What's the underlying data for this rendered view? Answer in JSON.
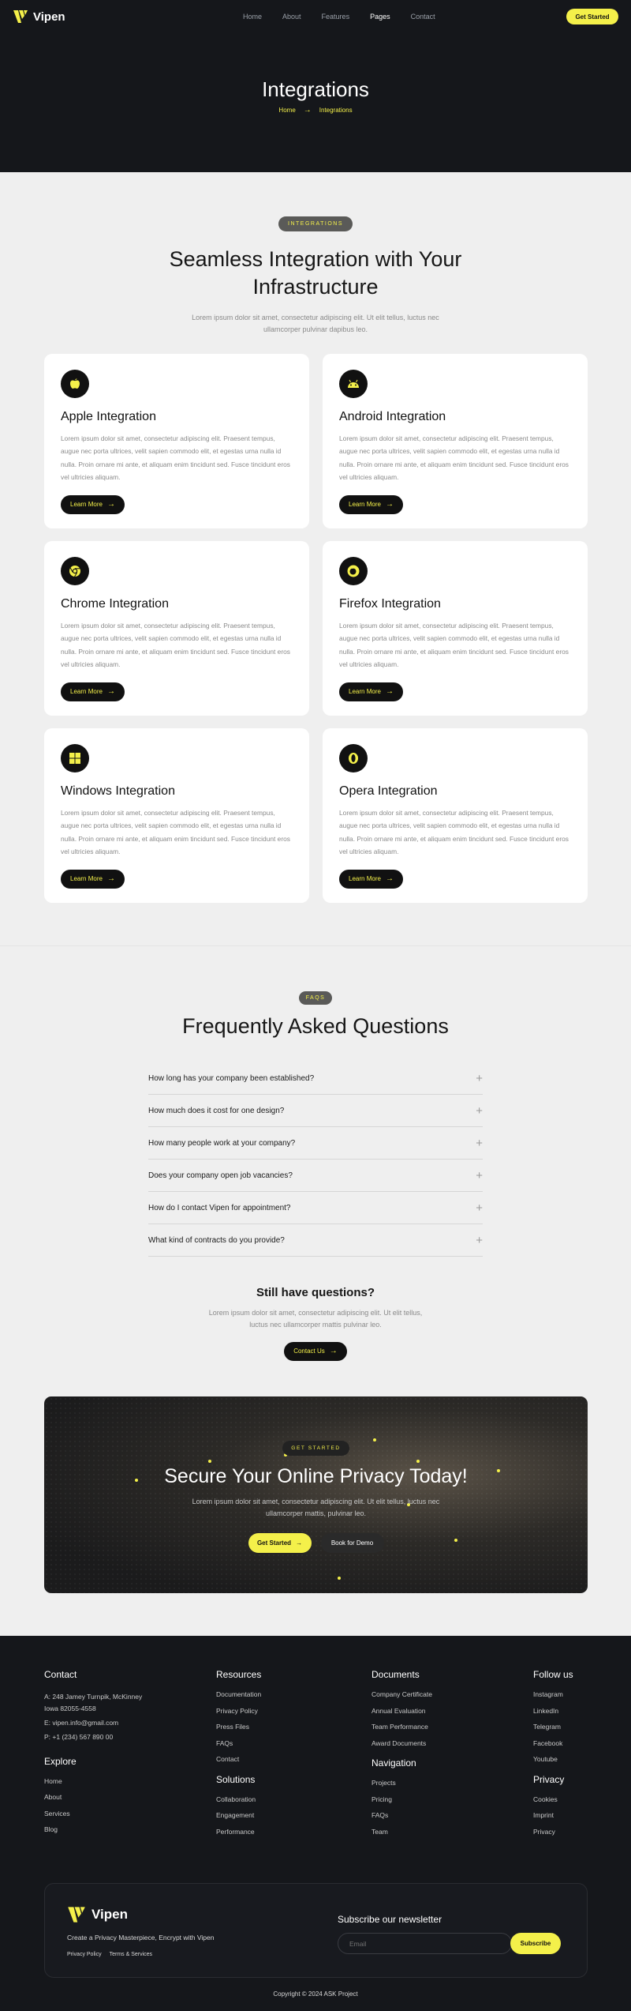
{
  "brand": {
    "name": "Vipen"
  },
  "nav": {
    "links": [
      "Home",
      "About",
      "Features",
      "Pages",
      "Contact"
    ],
    "cta": "Get Started"
  },
  "hero": {
    "title": "Integrations",
    "breadcrumb": [
      "Home",
      "Integrations"
    ]
  },
  "integrations": {
    "pill": "INTEGRATIONS",
    "title_line1": "Seamless Integration with Your",
    "title_line2": "Infrastructure",
    "sub_line1": "Lorem ipsum dolor sit amet, consectetur adipiscing elit. Ut elit tellus, luctus nec",
    "sub_line2": "ullamcorper pulvinar dapibus leo.",
    "body": "Lorem ipsum dolor sit amet, consectetur adipiscing elit. Praesent tempus, augue nec porta ultrices, velit sapien commodo elit, et egestas urna nulla id nulla. Proin ornare mi ante, et aliquam enim tincidunt sed. Fusce tincidunt eros vel ultricies aliquam.",
    "button": "Learn More",
    "cards": [
      {
        "title": "Apple Integration",
        "icon": "apple-icon"
      },
      {
        "title": "Android Integration",
        "icon": "android-icon"
      },
      {
        "title": "Chrome Integration",
        "icon": "chrome-icon"
      },
      {
        "title": "Firefox Integration",
        "icon": "firefox-icon"
      },
      {
        "title": "Windows Integration",
        "icon": "windows-icon"
      },
      {
        "title": "Opera Integration",
        "icon": "opera-icon"
      }
    ]
  },
  "faq": {
    "pill": "FAQS",
    "title": "Frequently Asked Questions",
    "items": [
      "How long has your company been established?",
      "How much does it cost for one design?",
      "How many people work at your company?",
      "Does your company open job vacancies?",
      "How do I contact Vipen for appointment?",
      "What kind of contracts do you provide?"
    ],
    "still_title": "Still have questions?",
    "still_sub_line1": "Lorem ipsum dolor sit amet, consectetur adipiscing elit. Ut elit tellus,",
    "still_sub_line2": "luctus nec ullamcorper mattis pulvinar leo.",
    "contact_button": "Contact Us"
  },
  "cta": {
    "pill": "GET STARTED",
    "title": "Secure Your Online Privacy Today!",
    "sub_line1": "Lorem ipsum dolor sit amet, consectetur adipiscing elit. Ut elit tellus, luctus nec",
    "sub_line2": "ullamcorper mattis, pulvinar leo.",
    "primary": "Get Started",
    "secondary": "Book for Demo"
  },
  "footer": {
    "contact": {
      "title": "Contact",
      "address_line1": "A: 248 Jamey Turnpik, McKinney",
      "address_line2": "Iowa 82055-4558",
      "email": "E: vipen.info@gmail.com",
      "phone": "P: +1 (234) 567 890 00"
    },
    "explore": {
      "title": "Explore",
      "links": [
        "Home",
        "About",
        "Services",
        "Blog"
      ]
    },
    "resources": {
      "title": "Resources",
      "links": [
        "Documentation",
        "Privacy Policy",
        "Press Files",
        "FAQs",
        "Contact"
      ]
    },
    "solutions": {
      "title": "Solutions",
      "links": [
        "Collaboration",
        "Engagement",
        "Performance"
      ]
    },
    "documents": {
      "title": "Documents",
      "links": [
        "Company Certificate",
        "Annual Evaluation",
        "Team Performance",
        "Award Documents"
      ]
    },
    "navigation": {
      "title": "Navigation",
      "links": [
        "Projects",
        "Pricing",
        "FAQs",
        "Team"
      ]
    },
    "follow": {
      "title": "Follow us",
      "links": [
        "Instagram",
        "LinkedIn",
        "Telegram",
        "Facebook",
        "Youtube"
      ]
    },
    "privacy": {
      "title": "Privacy",
      "links": [
        "Cookies",
        "Imprint",
        "Privacy"
      ]
    },
    "newsletter": {
      "tagline": "Create a Privacy Masterpiece, Encrypt with Vipen",
      "legal": [
        "Privacy Policy",
        "Terms & Services"
      ],
      "title": "Subscribe our newsletter",
      "placeholder": "Email",
      "button": "Subscribe"
    },
    "copyright": "Copyright © 2024 ASK Project"
  },
  "colors": {
    "accent": "#f4f04a",
    "dark": "#15171b",
    "light": "#efefef"
  }
}
